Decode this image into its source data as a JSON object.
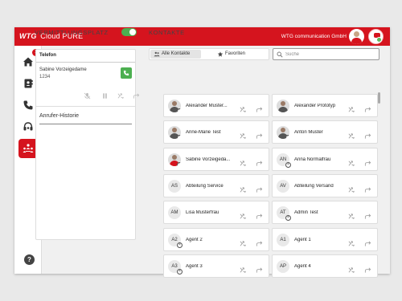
{
  "header": {
    "brand_logo": "WTG",
    "brand_name": "Cloud PURE",
    "company": "WTG communication GmbH"
  },
  "sidebar": {
    "items": [
      {
        "icon": "home-icon",
        "badge": "1"
      },
      {
        "icon": "contacts-book-icon"
      },
      {
        "icon": "phone-icon"
      },
      {
        "icon": "headset-icon"
      },
      {
        "icon": "switchboard-icon",
        "active": true
      }
    ],
    "help_label": "?"
  },
  "switchboard": {
    "title": "VERMITTLUNGSPLATZ",
    "toggle_on": true,
    "phone_header": "Telefon",
    "caller_name": "Sabine Vorzeigedame",
    "caller_number": "1234",
    "history_label": "Anrufer-Historie"
  },
  "contacts": {
    "title": "KONTAKTE",
    "tab_all": "Alle Kontakte",
    "tab_favorites": "Favoriten",
    "search_placeholder": "Suche",
    "items": [
      {
        "name": "Alexander Muster...",
        "avatar": "photo",
        "initials": ""
      },
      {
        "name": "Alexander Prototyp",
        "avatar": "photo",
        "initials": ""
      },
      {
        "name": "Anne-Marie Test",
        "avatar": "photo",
        "initials": ""
      },
      {
        "name": "Anton Muster",
        "avatar": "photo",
        "initials": ""
      },
      {
        "name": "Sabine Vorzeigeda...",
        "avatar": "photo-red",
        "initials": ""
      },
      {
        "name": "Anna Normalfrau",
        "avatar": "initials",
        "initials": "AN"
      },
      {
        "name": "Abteilung Service",
        "avatar": "initials",
        "initials": "AS"
      },
      {
        "name": "Abteilung Versand",
        "avatar": "initials",
        "initials": "AV"
      },
      {
        "name": "Lisa Musterfrau",
        "avatar": "initials",
        "initials": "AM"
      },
      {
        "name": "Admin Test",
        "avatar": "initials",
        "initials": "AT"
      },
      {
        "name": "Agent 2",
        "avatar": "initials",
        "initials": "A2"
      },
      {
        "name": "Agent 1",
        "avatar": "initials",
        "initials": "A1"
      },
      {
        "name": "Agent 3",
        "avatar": "initials",
        "initials": "A3"
      },
      {
        "name": "Agent 4",
        "avatar": "initials",
        "initials": "AP"
      }
    ]
  },
  "colors": {
    "brand": "#d5141e",
    "success": "#4caf50"
  }
}
